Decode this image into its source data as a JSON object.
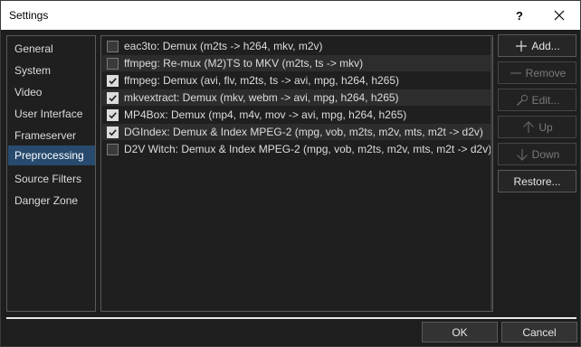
{
  "window": {
    "title": "Settings",
    "help_label": "?"
  },
  "sidebar": {
    "items": [
      {
        "label": "General",
        "selected": false
      },
      {
        "label": "System",
        "selected": false
      },
      {
        "label": "Video",
        "selected": false
      },
      {
        "label": "User Interface",
        "selected": false
      },
      {
        "label": "Frameserver",
        "selected": false
      },
      {
        "label": "Preprocessing",
        "selected": true
      },
      {
        "label": "Source Filters",
        "selected": false
      },
      {
        "label": "Danger Zone",
        "selected": false
      }
    ]
  },
  "list": {
    "items": [
      {
        "label": "eac3to: Demux (m2ts -> h264, mkv, m2v)",
        "checked": false
      },
      {
        "label": "ffmpeg: Re-mux (M2)TS to MKV (m2ts, ts -> mkv)",
        "checked": false
      },
      {
        "label": "ffmpeg: Demux (avi, flv, m2ts, ts -> avi, mpg, h264, h265)",
        "checked": true
      },
      {
        "label": "mkvextract: Demux (mkv, webm -> avi, mpg, h264, h265)",
        "checked": true
      },
      {
        "label": "MP4Box: Demux (mp4, m4v, mov -> avi, mpg, h264, h265)",
        "checked": true
      },
      {
        "label": "DGIndex: Demux & Index MPEG-2 (mpg, vob, m2ts, m2v, mts, m2t -> d2v)",
        "checked": true
      },
      {
        "label": "D2V Witch: Demux & Index MPEG-2 (mpg, vob, m2ts, m2v, mts, m2t -> d2v)",
        "checked": false
      }
    ]
  },
  "actions": {
    "add": "Add...",
    "remove": "Remove",
    "edit": "Edit...",
    "up": "Up",
    "down": "Down",
    "restore": "Restore..."
  },
  "footer": {
    "ok": "OK",
    "cancel": "Cancel"
  },
  "colors": {
    "background": "#1e1e1e",
    "selection": "#274a6e",
    "titlebar": "#ffffff"
  }
}
